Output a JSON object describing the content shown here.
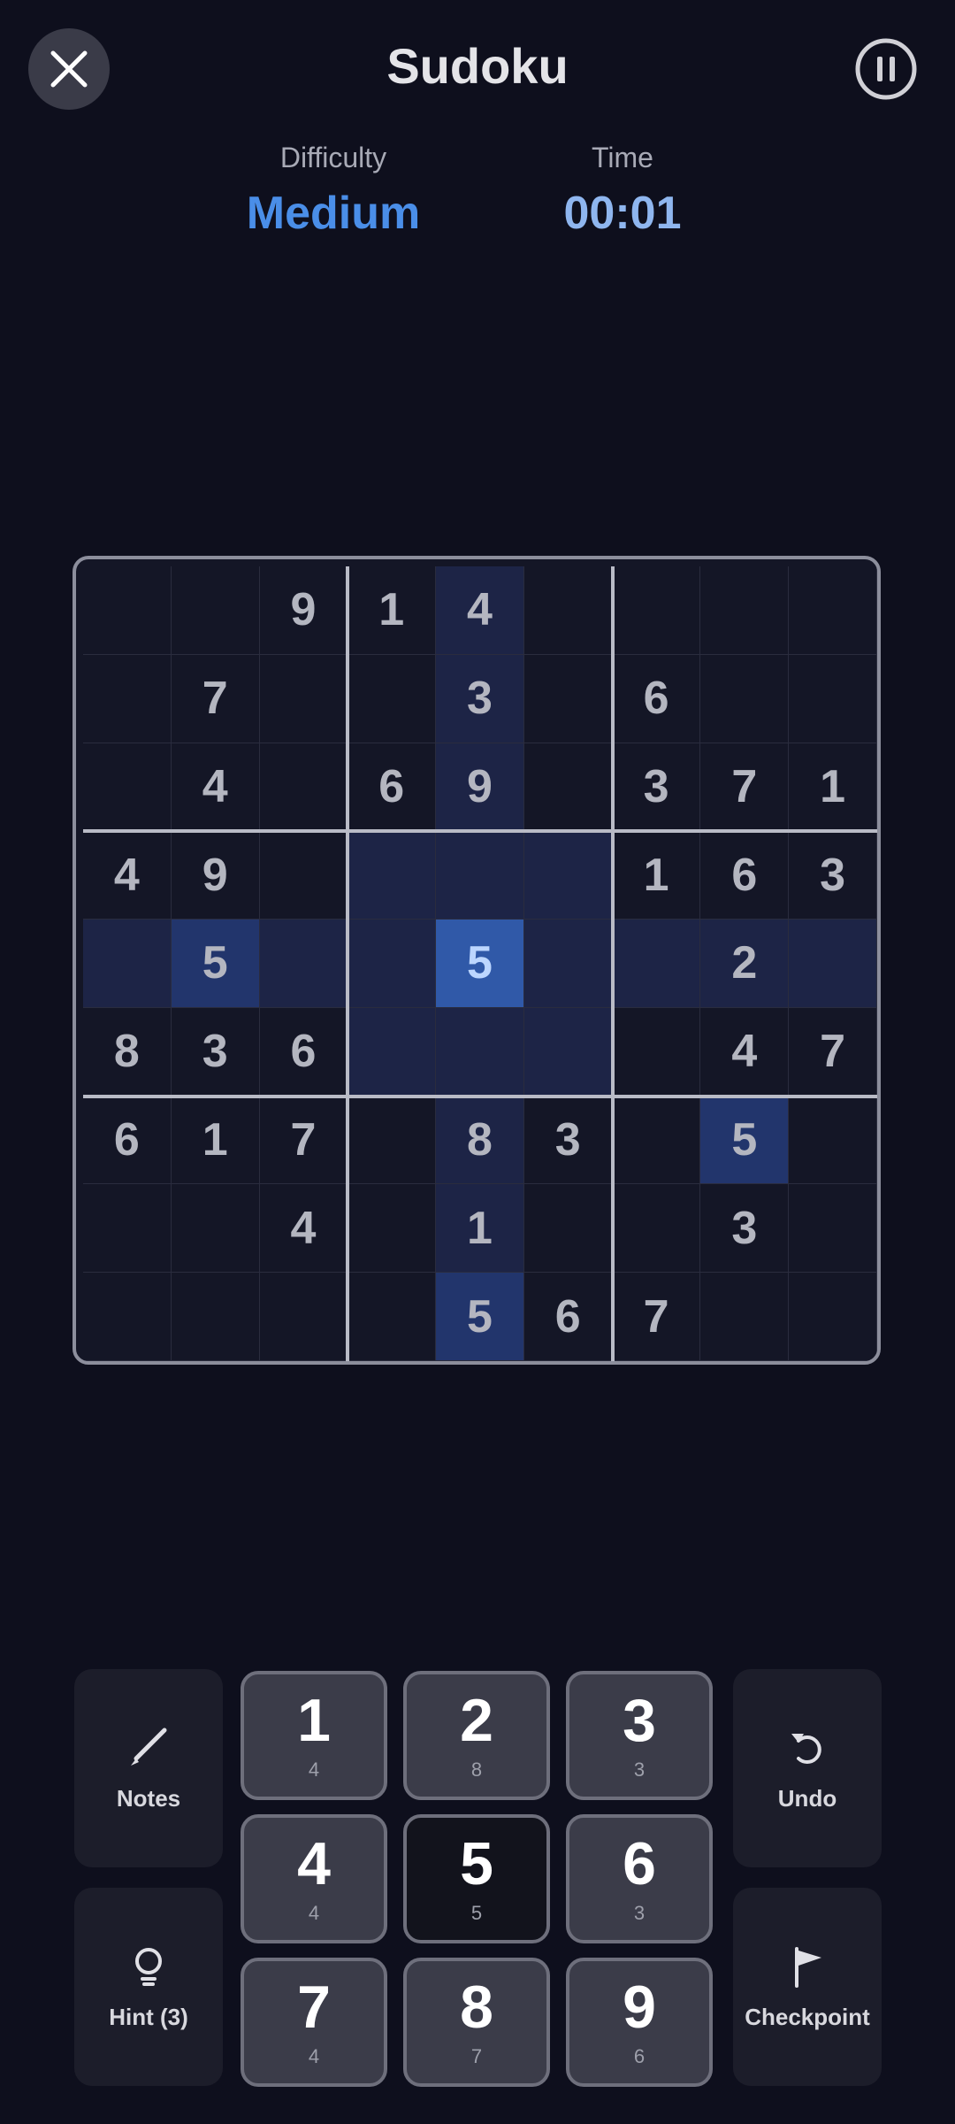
{
  "header": {
    "title": "Sudoku",
    "close_icon": "close-icon",
    "pause_icon": "pause-icon"
  },
  "info": {
    "difficulty_label": "Difficulty",
    "difficulty_value": "Medium",
    "time_label": "Time",
    "time_value": "00:01"
  },
  "board": {
    "cells": [
      [
        "",
        "",
        "9",
        "1",
        "4",
        "",
        "",
        "",
        ""
      ],
      [
        "",
        "7",
        "",
        "",
        "3",
        "",
        "6",
        "",
        ""
      ],
      [
        "",
        "4",
        "",
        "6",
        "9",
        "",
        "3",
        "7",
        "1"
      ],
      [
        "4",
        "9",
        "",
        "",
        "",
        "",
        "1",
        "6",
        "3"
      ],
      [
        "",
        "5",
        "",
        "",
        "5",
        "",
        "",
        "2",
        ""
      ],
      [
        "8",
        "3",
        "6",
        "",
        "",
        "",
        "",
        "4",
        "7"
      ],
      [
        "6",
        "1",
        "7",
        "",
        "8",
        "3",
        "",
        "5",
        ""
      ],
      [
        "",
        "",
        "4",
        "",
        "1",
        "",
        "",
        "3",
        ""
      ],
      [
        "",
        "",
        "",
        "",
        "5",
        "6",
        "7",
        "",
        ""
      ]
    ],
    "selected": {
      "row": 4,
      "col": 4
    },
    "colors": {
      "highlight": "#1d2446",
      "same_number": "#22356c",
      "selected": "#3059a8"
    }
  },
  "controls": {
    "notes_label": "Notes",
    "undo_label": "Undo",
    "hint_label": "Hint (3)",
    "checkpoint_label": "Checkpoint"
  },
  "numpad": [
    {
      "number": "1",
      "count": "4"
    },
    {
      "number": "2",
      "count": "8"
    },
    {
      "number": "3",
      "count": "3"
    },
    {
      "number": "4",
      "count": "4"
    },
    {
      "number": "5",
      "count": "5"
    },
    {
      "number": "6",
      "count": "3"
    },
    {
      "number": "7",
      "count": "4"
    },
    {
      "number": "8",
      "count": "7"
    },
    {
      "number": "9",
      "count": "6"
    }
  ]
}
